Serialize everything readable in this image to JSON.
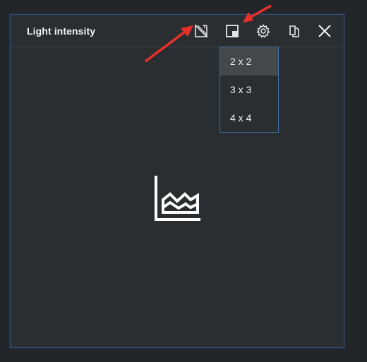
{
  "panel": {
    "title": "Light intensity"
  },
  "toolbar": {
    "buttons": [
      {
        "name": "measure-icon"
      },
      {
        "name": "layout-icon"
      },
      {
        "name": "gear-icon"
      },
      {
        "name": "copy-icon"
      },
      {
        "name": "close-icon"
      }
    ]
  },
  "layout_menu": {
    "items": [
      {
        "label": "2 x 2",
        "selected": true
      },
      {
        "label": "3 x 3",
        "selected": false
      },
      {
        "label": "4 x 4",
        "selected": false
      }
    ]
  },
  "placeholder": {
    "icon": "area-chart-icon"
  },
  "colors": {
    "accent_border": "#3b6fa8",
    "annotation_arrow": "#e8302a"
  }
}
